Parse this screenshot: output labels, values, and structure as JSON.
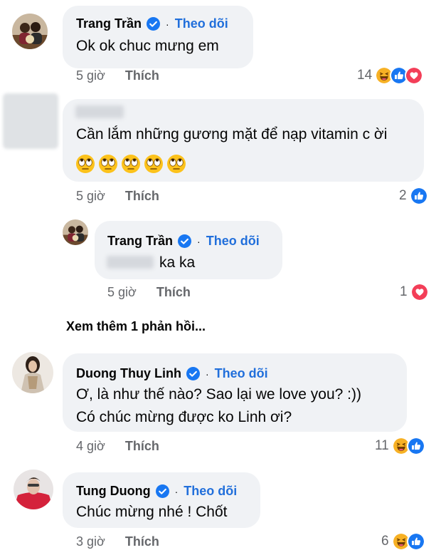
{
  "comments": [
    {
      "author": "Trang Trần",
      "follow": "Theo dõi",
      "dot": "·",
      "text": "Ok ok chuc mưng em",
      "time": "5 giờ",
      "like": "Thích",
      "reaction_count": "14",
      "reactions": [
        "haha-icon",
        "like-icon",
        "love-icon"
      ]
    },
    {
      "author": "",
      "text": "Cần lắm những gương mặt để nạp vitamin c ời",
      "emoji_count": 5,
      "time": "5 giờ",
      "like": "Thích",
      "reaction_count": "2",
      "reactions": [
        "like-icon"
      ]
    },
    {
      "author": "Trang Trần",
      "follow": "Theo dõi",
      "dot": "·",
      "text": "ka ka",
      "time": "5 giờ",
      "like": "Thích",
      "reaction_count": "1",
      "reactions": [
        "love-icon"
      ]
    },
    {
      "author": "Duong Thuy Linh",
      "follow": "Theo dõi",
      "dot": "·",
      "text_line1": "Ơ, là như thế nào? Sao lại we love you? :))",
      "text_line2": "Có chúc mừng được ko Linh ơi?",
      "time": "4 giờ",
      "like": "Thích",
      "reaction_count": "11",
      "reactions": [
        "haha-icon",
        "like-icon"
      ]
    },
    {
      "author": "Tung Duong",
      "follow": "Theo dõi",
      "dot": "·",
      "text": "Chúc mừng nhé ! Chốt",
      "time": "3 giờ",
      "like": "Thích",
      "reaction_count": "6",
      "reactions": [
        "haha-icon",
        "like-icon"
      ]
    }
  ],
  "view_more_replies": "Xem thêm 1 phản hồi...",
  "colors": {
    "bubble": "#f0f2f5",
    "follow": "#216fdb",
    "meta": "#65676b",
    "like": "#1877f2",
    "love": "#f33e58",
    "haha": "#f7b125"
  }
}
